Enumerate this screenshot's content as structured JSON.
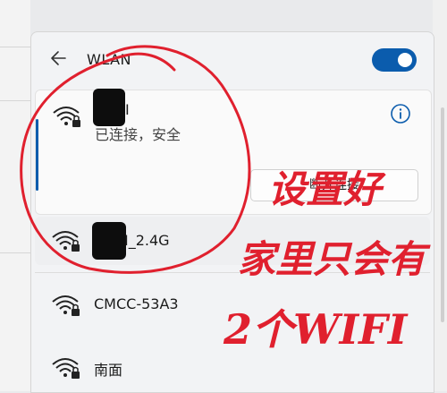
{
  "header": {
    "title": "WLAN",
    "toggle_on": true
  },
  "networks": [
    {
      "name": "I",
      "status": "已连接，安全",
      "secured": true,
      "action_label": "断开连接"
    },
    {
      "name": "I_2.4G",
      "secured": true
    },
    {
      "name": "CMCC-53A3",
      "secured": true
    },
    {
      "name": "南面",
      "secured": true
    }
  ],
  "annotation": {
    "lines": [
      "设置好",
      "家里只会有",
      "2个WIFI"
    ],
    "color": "#e0202e"
  },
  "colors": {
    "accent": "#0b5cad",
    "annotation": "#e0202e"
  },
  "icons": [
    "back-arrow-icon",
    "wifi-secured-icon",
    "info-icon"
  ]
}
